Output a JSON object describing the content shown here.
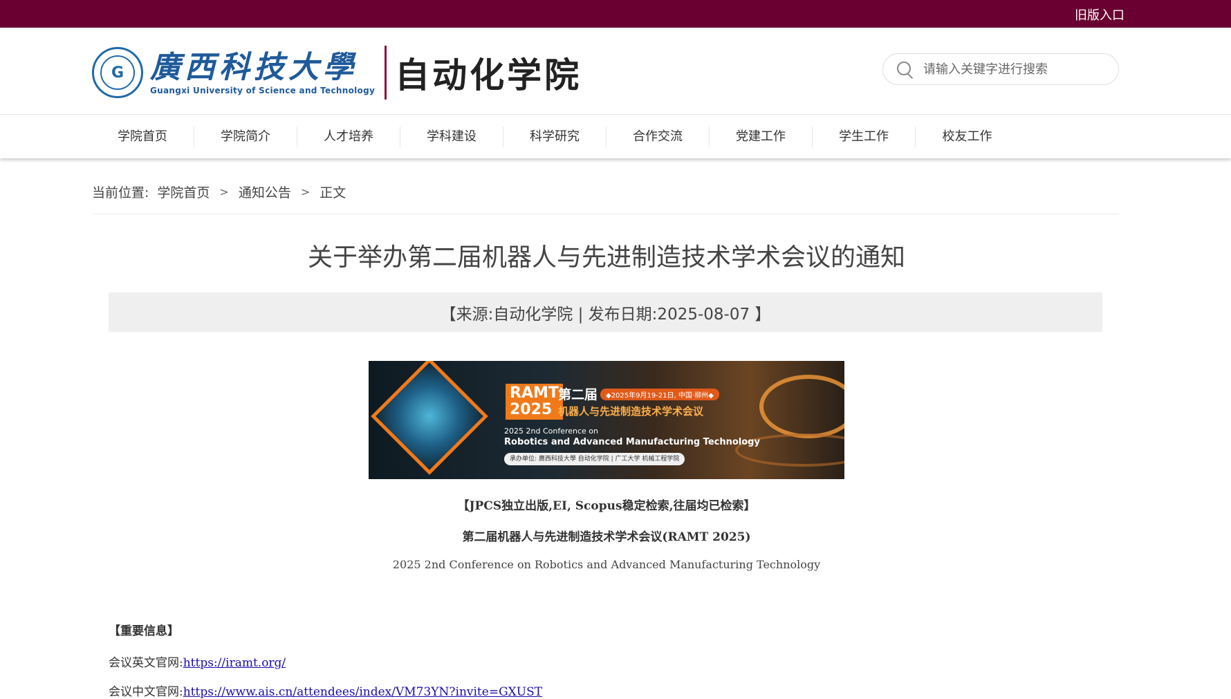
{
  "topbar": {
    "old_version_link": "旧版入口",
    "color": "#6a0032"
  },
  "header": {
    "university_cn": "廣西科技大學",
    "university_en": "Guangxi University of Science and Technology",
    "college_name": "自动化学院",
    "search": {
      "placeholder": "请输入关键字进行搜索"
    }
  },
  "nav": {
    "items": [
      "学院首页",
      "学院简介",
      "人才培养",
      "学科建设",
      "科学研究",
      "合作交流",
      "党建工作",
      "学生工作",
      "校友工作"
    ]
  },
  "breadcrumb": {
    "label": "当前位置:",
    "items": [
      "学院首页",
      "通知公告",
      "正文"
    ],
    "separator": ">"
  },
  "article": {
    "title": "关于举办第二届机器人与先进制造技术学术会议的通知",
    "meta": "【来源:自动化学院 | 发布日期:2025-08-07 】",
    "banner": {
      "badge": "RAMT",
      "badge_year": "2025",
      "edition": "第二届",
      "date": "◆2025年9月19-21日, 中国·柳州◆",
      "cn_name": "机器人与先进制造技术学术会议",
      "en_line1": "2025 2nd Conference on",
      "en_line2": "Robotics and Advanced Manufacturing Technology",
      "organizer": "承办单位: 廣西科技大學 自动化学院 | 广工大学 机械工程学院"
    },
    "para1": "【JPCS独立出版,EI, Scopus稳定检索,往届均已检索】",
    "para2": "第二届机器人与先进制造技术学术会议(RAMT 2025)",
    "para3": "2025 2nd Conference on Robotics and Advanced Manufacturing Technology",
    "important_heading": "【重要信息】",
    "en_site_label": "会议英文官网:",
    "en_site_url": "https://iramt.org/",
    "cn_site_label": "会议中文官网:",
    "cn_site_url": "https://www.ais.cn/attendees/index/VM73YN?invite=GXUST"
  }
}
